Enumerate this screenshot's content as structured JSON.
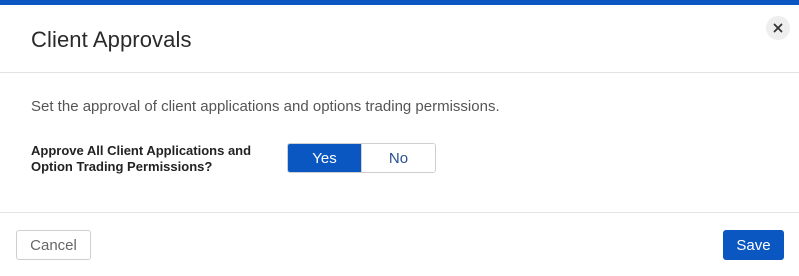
{
  "dialog": {
    "title": "Client Approvals",
    "close_icon": "close-icon",
    "accent_color": "#0b57c2"
  },
  "body": {
    "description": "Set the approval of client applications and options trading permissions.",
    "field_label": "Approve All Client Applications and Option Trading Permissions?",
    "toggle": {
      "options": [
        "Yes",
        "No"
      ],
      "selected": "Yes"
    }
  },
  "footer": {
    "cancel_label": "Cancel",
    "save_label": "Save"
  }
}
